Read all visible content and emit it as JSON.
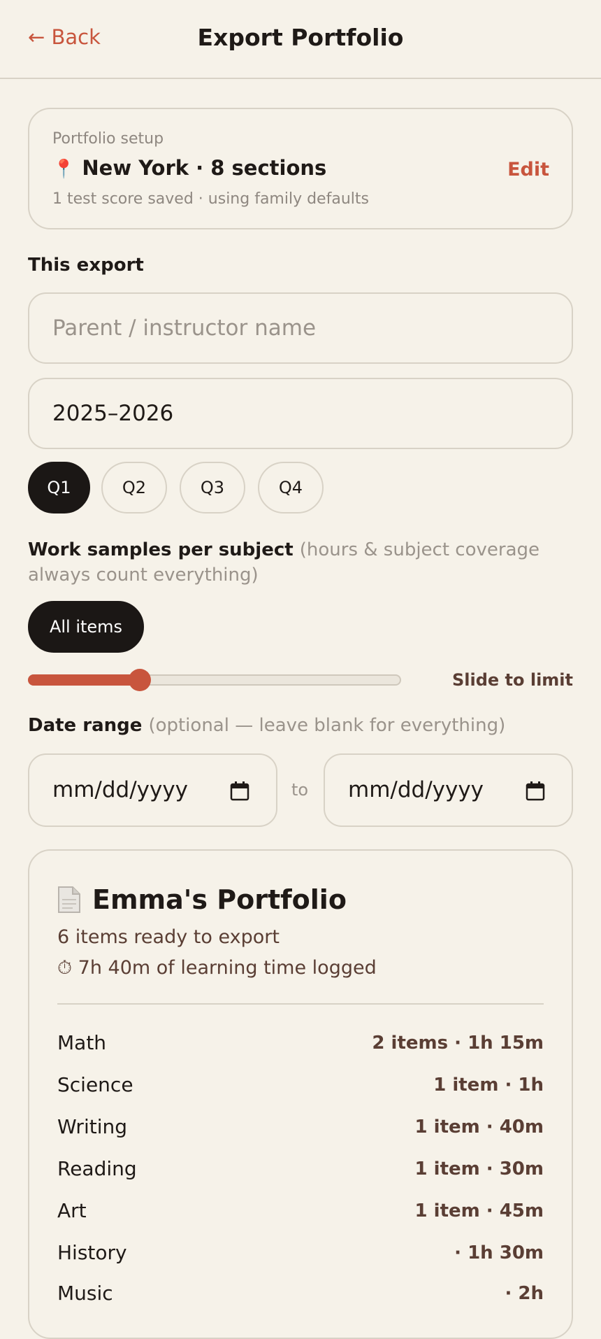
{
  "header": {
    "back_label": "← Back",
    "title": "Export Portfolio"
  },
  "setup": {
    "label": "Portfolio setup",
    "pin_icon": "📍",
    "location": "New York · 8 sections",
    "subtext": "1 test score saved · using family defaults",
    "edit_label": "Edit"
  },
  "this_export": {
    "label": "This export",
    "name_placeholder": "Parent / instructor name",
    "year_value": "2025–2026",
    "quarters": [
      "Q1",
      "Q2",
      "Q3",
      "Q4"
    ],
    "active_quarter": "Q1"
  },
  "samples": {
    "label": "Work samples per subject",
    "note": "(hours & subject coverage always count everything)",
    "all_items_label": "All items",
    "slider_level": 0.3,
    "slide_label": "Slide to limit"
  },
  "date_range": {
    "label": "Date range",
    "note": "(optional — leave blank for everything)",
    "start_placeholder": "mm/dd/yyyy",
    "end_placeholder": "mm/dd/yyyy",
    "to_label": "to"
  },
  "portfolio": {
    "title": "Emma's Portfolio",
    "count_text": "6 items ready to export",
    "time_text": "⏱ 7h 40m of learning time logged",
    "rows": [
      {
        "subject": "Math",
        "value": "2 items · 1h 15m"
      },
      {
        "subject": "Science",
        "value": "1 item · 1h"
      },
      {
        "subject": "Writing",
        "value": "1 item · 40m"
      },
      {
        "subject": "Reading",
        "value": "1 item · 30m"
      },
      {
        "subject": "Art",
        "value": "1 item · 45m"
      },
      {
        "subject": "History",
        "value": "· 1h 30m"
      },
      {
        "subject": "Music",
        "value": "· 2h"
      }
    ]
  },
  "colors": {
    "accent": "#c8553d",
    "background": "#f6f2e9",
    "active_pill": "#1b1715"
  }
}
